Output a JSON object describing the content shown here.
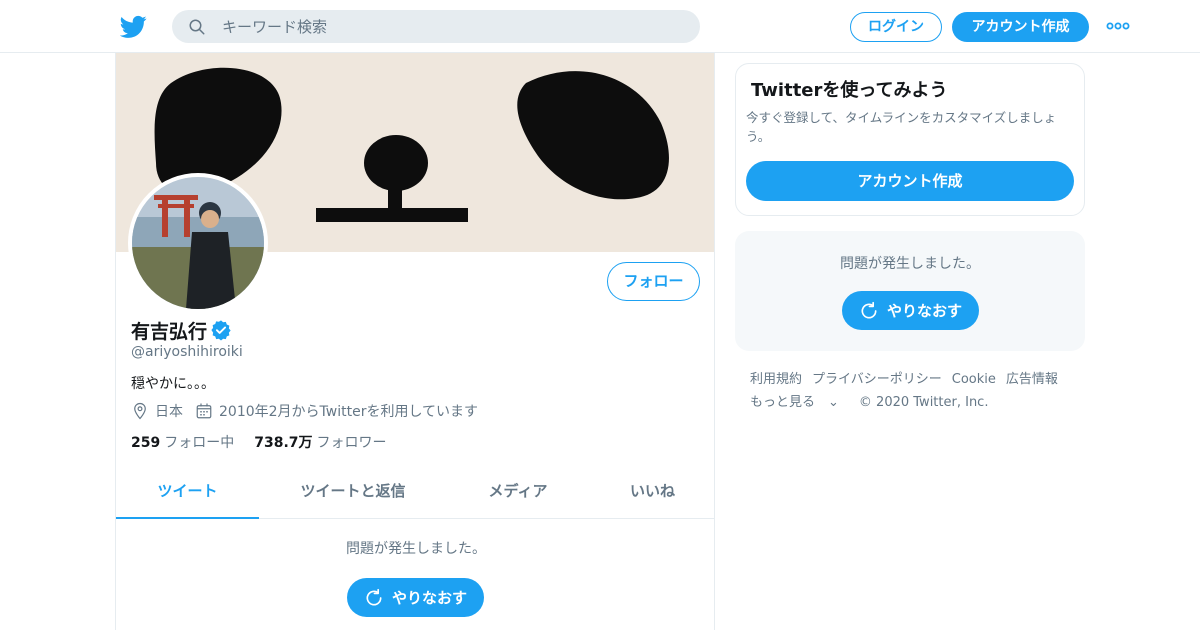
{
  "header": {
    "logo_icon": "twitter-bird-icon",
    "search": {
      "placeholder": "キーワード検索",
      "icon": "search-icon"
    },
    "login_label": "ログイン",
    "signup_label": "アカウント作成",
    "more_icon": "more-dots-icon"
  },
  "profile": {
    "name": "有吉弘行",
    "verified_icon": "verified-badge-icon",
    "handle": "@ariyoshihiroiki",
    "bio": "穏やかに。。。",
    "location": "日本",
    "joined": "2010年2月からTwitterを利用しています",
    "following_count": "259",
    "following_label": "フォロー中",
    "followers_count": "738.7万",
    "followers_label": "フォロワー",
    "follow_label": "フォロー"
  },
  "tabs": [
    {
      "label": "ツイート",
      "active": true
    },
    {
      "label": "ツイートと返信",
      "active": false
    },
    {
      "label": "メディア",
      "active": false
    },
    {
      "label": "いいね",
      "active": false
    }
  ],
  "timeline": {
    "error_text": "問題が発生しました。",
    "retry_label": "やりなおす"
  },
  "sidebar": {
    "card_title": "Twitterを使ってみよう",
    "card_text": "今すぐ登録して、タイムラインをカスタマイズしましょう。",
    "card_button": "アカウント作成",
    "error_text": "問題が発生しました。",
    "retry_label": "やりなおす",
    "footer_links": [
      "利用規約",
      "プライバシーポリシー",
      "Cookie",
      "広告情報"
    ],
    "footer_more": "もっと見る",
    "copyright": "© 2020 Twitter, Inc."
  },
  "colors": {
    "accent": "#1da1f2",
    "secondary_text": "#657786",
    "border": "#e6ecf0"
  }
}
